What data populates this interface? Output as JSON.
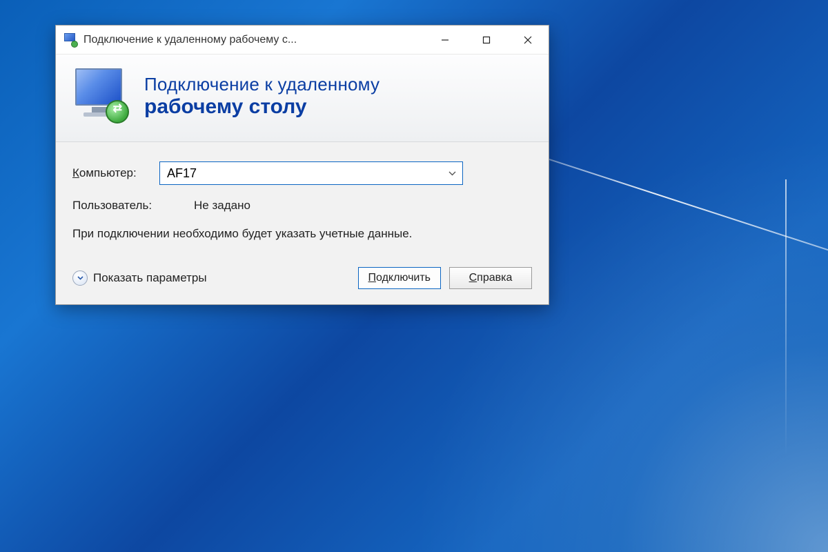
{
  "window": {
    "title": "Подключение к удаленному рабочему с..."
  },
  "header": {
    "line1": "Подключение к удаленному",
    "line2": "рабочему столу"
  },
  "form": {
    "computer_label_prefix": "К",
    "computer_label_rest": "омпьютер:",
    "computer_value": "AF17",
    "user_label": "Пользователь:",
    "user_value": "Не задано",
    "info": "При подключении необходимо будет указать учетные данные."
  },
  "footer": {
    "show_options_prefix": "П",
    "show_options_rest": "оказать параметры",
    "connect_prefix": "П",
    "connect_rest": "одключить",
    "help_prefix": "С",
    "help_rest": "правка"
  }
}
